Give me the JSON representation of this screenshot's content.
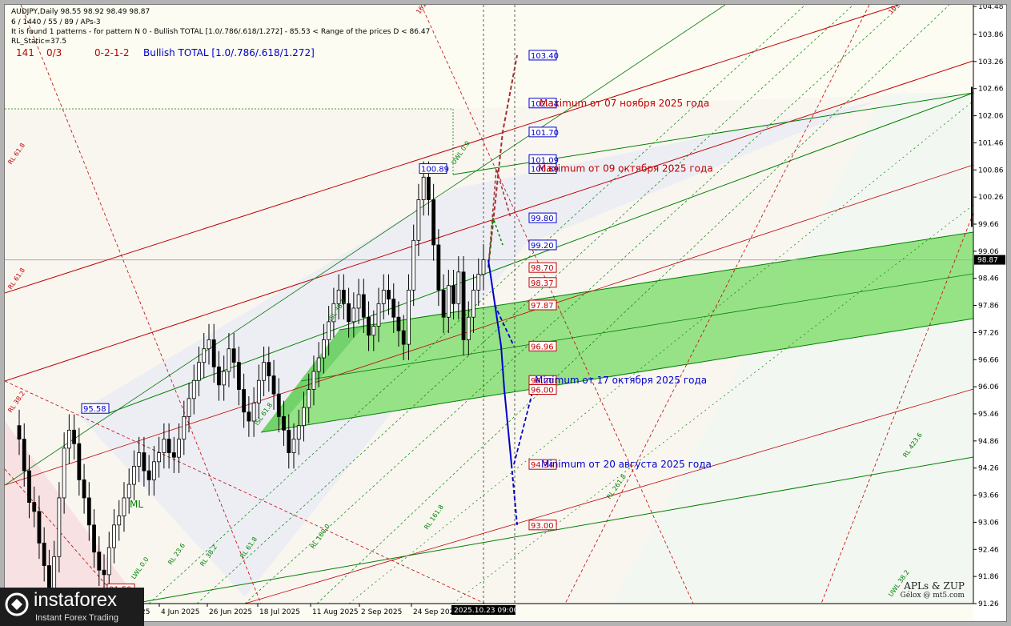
{
  "header": {
    "line1": "AUDJPY,Daily  98.55 98.92 98.49 98.87",
    "line2": "6 / 1440 / 55 / 89 / APs-3",
    "line3": "It is found 1 patterns  -  for pattern N 0 - Bullish TOTAL [1.0/.786/.618/1.272] - 85.53 < Range of the prices D < 86.47",
    "line4": "RL_Static=37.5",
    "n141": "141",
    "n03": "0/3",
    "code": "0-2-1-2",
    "pattern": "Bullish TOTAL [1.0/.786/.618/1.272]"
  },
  "colors": {
    "background": "#fcfcf2",
    "red": "#c00000",
    "green": "#008000",
    "blue": "#0000cc",
    "brown": "#993333",
    "channel_fill": "#8ce07a"
  },
  "annotations": {
    "max_nov": "Maximum от 07 ноября 2025 года",
    "max_oct": "Maximum от 09 октября 2025 года",
    "min_oct": "Minimum от 17 октября 2025 года",
    "min_aug": "Minimum от 20 августа 2025 года",
    "ml": "ML"
  },
  "signature": {
    "title": "APLs & ZUP",
    "author": "Gélox @ mt5.com"
  },
  "logo": {
    "name": "instaforex",
    "tagline": "Instant Forex Trading"
  },
  "chart_data": {
    "type": "candlestick",
    "symbol": "AUDJPY",
    "timeframe": "Daily",
    "ohlc": {
      "open": 98.55,
      "high": 98.92,
      "low": 98.49,
      "close": 98.87
    },
    "current_price": "98.87",
    "ylim": [
      91.26,
      104.48
    ],
    "y_ticks": [
      "104.48",
      "103.86",
      "103.26",
      "102.66",
      "102.06",
      "101.46",
      "100.86",
      "100.26",
      "99.66",
      "99.06",
      "98.46",
      "97.86",
      "97.26",
      "96.66",
      "96.06",
      "95.46",
      "94.86",
      "94.26",
      "93.66",
      "93.06",
      "92.46",
      "91.86",
      "91.26"
    ],
    "x_ticks": [
      "25",
      "4 Jun 2025",
      "26 Jun 2025",
      "18 Jul 2025",
      "11 Aug 2025",
      "2 Sep 2025",
      "24 Sep 2025"
    ],
    "crosshair_time": "2025.10.23 09:00",
    "closes": [
      94.9,
      94.2,
      93.5,
      93.3,
      92.6,
      92.1,
      91.6,
      92.3,
      93.6,
      94.7,
      95.1,
      94.8,
      94.0,
      93.6,
      93.0,
      92.4,
      92.0,
      91.9,
      92.5,
      93.0,
      93.2,
      93.6,
      93.9,
      94.3,
      94.6,
      94.2,
      94.0,
      94.4,
      94.6,
      94.9,
      94.6,
      94.5,
      94.9,
      95.4,
      95.8,
      96.2,
      96.6,
      96.9,
      97.1,
      96.5,
      96.1,
      96.4,
      96.9,
      96.6,
      96.0,
      95.5,
      95.3,
      95.7,
      96.2,
      96.6,
      96.3,
      95.9,
      95.4,
      95.1,
      94.6,
      94.9,
      95.2,
      95.6,
      96.0,
      96.4,
      96.7,
      97.1,
      97.5,
      97.9,
      98.2,
      97.9,
      97.5,
      97.8,
      98.1,
      97.6,
      97.2,
      97.4,
      97.9,
      98.2,
      98.0,
      97.6,
      97.3,
      97.0,
      98.2,
      99.3,
      100.2,
      100.7,
      100.2,
      99.2,
      98.2,
      97.6,
      98.3,
      97.9,
      98.6,
      97.1,
      97.6,
      98.2,
      98.55,
      98.87
    ],
    "price_labels": [
      {
        "value": "103.40",
        "kind": "blue"
      },
      {
        "value": "102.34",
        "kind": "blue"
      },
      {
        "value": "101.70",
        "kind": "blue"
      },
      {
        "value": "101.09",
        "kind": "blue"
      },
      {
        "value": "100.89",
        "kind": "blue"
      },
      {
        "value": "99.80",
        "kind": "blue"
      },
      {
        "value": "99.20",
        "kind": "blue"
      },
      {
        "value": "98.70",
        "kind": "red"
      },
      {
        "value": "98.37",
        "kind": "red"
      },
      {
        "value": "97.87",
        "kind": "red"
      },
      {
        "value": "96.96",
        "kind": "red"
      },
      {
        "value": "96.20",
        "kind": "red"
      },
      {
        "value": "96.00",
        "kind": "red"
      },
      {
        "value": "94.34",
        "kind": "red"
      },
      {
        "value": "93.00",
        "kind": "red"
      },
      {
        "value": "95.58",
        "kind": "blue"
      },
      {
        "value": "100.89",
        "kind": "blue"
      },
      {
        "value": "91.59",
        "kind": "red"
      }
    ],
    "level_labels": [
      "161.8",
      "161.8",
      "RL 61.8",
      "RL 61.8",
      "RL 38.2",
      "ISL 38.2",
      "ISL 61.8",
      "UWL 0.0",
      "LWL 0.0",
      "RL 23.6",
      "RL 38.2",
      "RL 61.8",
      "RL 100.0",
      "RL 161.8",
      "RL 261.8",
      "RL 423.6",
      "UWL 38.2"
    ]
  }
}
